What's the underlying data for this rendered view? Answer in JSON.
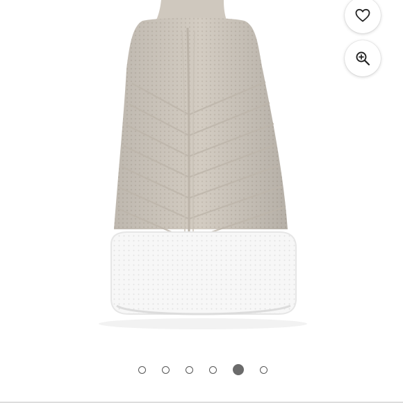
{
  "product_image": {
    "icon": "sock-sneaker-back-view"
  },
  "actions": {
    "favorite_icon": "heart-outline-icon",
    "zoom_icon": "zoom-in-icon"
  },
  "carousel": {
    "count": 6,
    "active_index": 4
  },
  "colors": {
    "knit": "#d2cbc1",
    "sole": "#f6f6f6",
    "dot_active": "#6b6b6b",
    "dot_inactive": "#555555"
  }
}
